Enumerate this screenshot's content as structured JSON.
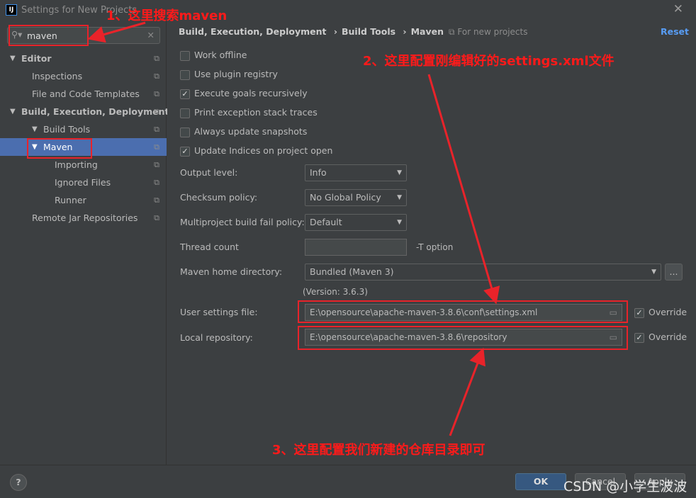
{
  "window": {
    "title": "Settings for New Projects",
    "logo": "IJ"
  },
  "search": {
    "value": "maven"
  },
  "tree": [
    {
      "label": "Editor",
      "level": 0,
      "expanded": true
    },
    {
      "label": "Inspections",
      "level": 1
    },
    {
      "label": "File and Code Templates",
      "level": 1
    },
    {
      "label": "Build, Execution, Deployment",
      "level": 0,
      "expanded": true
    },
    {
      "label": "Build Tools",
      "level": 1,
      "expanded": true
    },
    {
      "label": "Maven",
      "level": 2,
      "expanded": true,
      "selected": true
    },
    {
      "label": "Importing",
      "level": 3
    },
    {
      "label": "Ignored Files",
      "level": 3
    },
    {
      "label": "Runner",
      "level": 3
    },
    {
      "label": "Remote Jar Repositories",
      "level": 1
    }
  ],
  "breadcrumb": [
    "Build, Execution, Deployment",
    "Build Tools",
    "Maven"
  ],
  "scope": "For new projects",
  "reset": "Reset",
  "checkboxes": [
    {
      "label": "Work offline",
      "checked": false
    },
    {
      "label": "Use plugin registry",
      "checked": false
    },
    {
      "label": "Execute goals recursively",
      "checked": true
    },
    {
      "label": "Print exception stack traces",
      "checked": false
    },
    {
      "label": "Always update snapshots",
      "checked": false
    },
    {
      "label": "Update Indices on project open",
      "checked": true
    }
  ],
  "fields": {
    "output_level": {
      "label": "Output level:",
      "value": "Info"
    },
    "checksum": {
      "label": "Checksum policy:",
      "value": "No Global Policy"
    },
    "multiproject": {
      "label": "Multiproject build fail policy:",
      "value": "Default"
    },
    "thread": {
      "label": "Thread count",
      "value": "",
      "hint": "-T option"
    },
    "maven_home": {
      "label": "Maven home directory:",
      "value": "Bundled (Maven 3)",
      "browse": "...",
      "version": "(Version: 3.6.3)"
    },
    "user_settings": {
      "label": "User settings file:",
      "value": "E:\\opensource\\apache-maven-3.8.6\\conf\\settings.xml",
      "override": "Override",
      "override_checked": true
    },
    "local_repo": {
      "label": "Local repository:",
      "value": "E:\\opensource\\apache-maven-3.8.6\\repository",
      "override": "Override",
      "override_checked": true
    }
  },
  "footer": {
    "help": "?",
    "ok": "OK",
    "cancel": "Cancel",
    "apply": "Apply"
  },
  "annotations": {
    "a1": "1、这里搜索maven",
    "a2": "2、这里配置刚编辑好的settings.xml文件",
    "a3": "3、这里配置我们新建的仓库目录即可"
  },
  "watermark": "CSDN @小学生波波",
  "colors": {
    "selection": "#4b6eaf",
    "annotation": "#e8232a",
    "ok": "#365880"
  }
}
